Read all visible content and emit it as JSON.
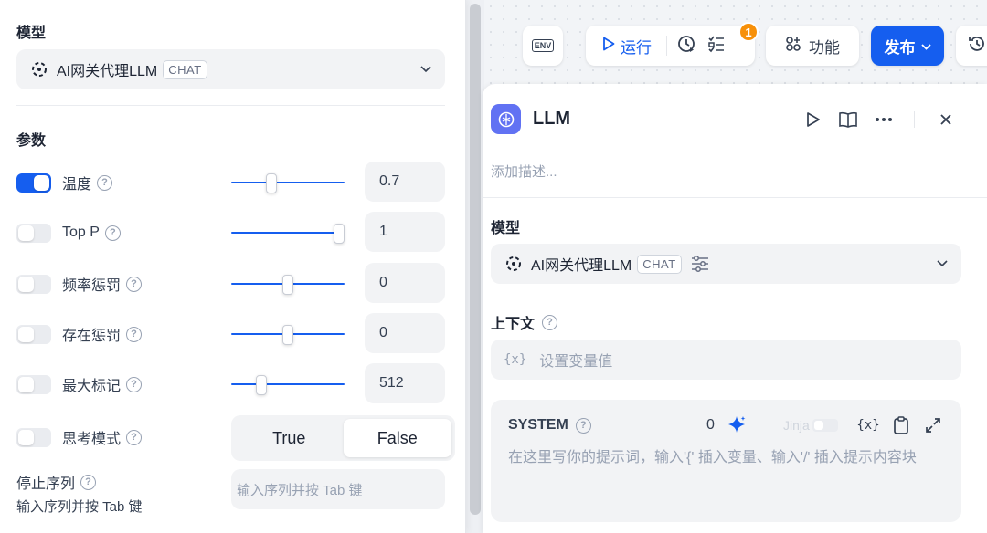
{
  "left_panel": {
    "model_section_title": "模型",
    "model": {
      "name": "AI网关代理LLM",
      "badge": "CHAT"
    },
    "params_section_title": "参数",
    "params": [
      {
        "label": "温度",
        "enabled": true,
        "value": "0.7",
        "slider_fraction": 0.35
      },
      {
        "label": "Top P",
        "enabled": false,
        "value": "1",
        "slider_fraction": 1.0
      },
      {
        "label": "频率惩罚",
        "enabled": false,
        "value": "0",
        "slider_fraction": 0.5
      },
      {
        "label": "存在惩罚",
        "enabled": false,
        "value": "0",
        "slider_fraction": 0.5
      },
      {
        "label": "最大标记",
        "enabled": false,
        "value": "512",
        "slider_fraction": 0.25
      }
    ],
    "thinking_mode": {
      "label": "思考模式",
      "enabled": false,
      "options": [
        "True",
        "False"
      ],
      "selected": "False"
    },
    "stop_sequence": {
      "label": "停止序列",
      "hint": "输入序列并按 Tab 键",
      "placeholder": "输入序列并按 Tab 键"
    }
  },
  "toolbar": {
    "env_label": "ENV",
    "run_label": "运行",
    "checklist_badge": "1",
    "feature_label": "功能",
    "publish_label": "发布"
  },
  "node": {
    "title": "LLM",
    "description_placeholder": "添加描述...",
    "model_section_title": "模型",
    "model": {
      "name": "AI网关代理LLM",
      "badge": "CHAT"
    },
    "context_title": "上下文",
    "context_var_icon": "{x}",
    "context_placeholder": "设置变量值",
    "system": {
      "title": "SYSTEM",
      "char_count": "0",
      "jinja_label": "Jinja",
      "var_icon": "{x}",
      "placeholder": "在这里写你的提示词，输入'{' 插入变量、输入'/' 插入提示内容块"
    }
  },
  "colors": {
    "primary": "#155eef",
    "badge": "#f79009",
    "node_icon": "#6172f3"
  }
}
